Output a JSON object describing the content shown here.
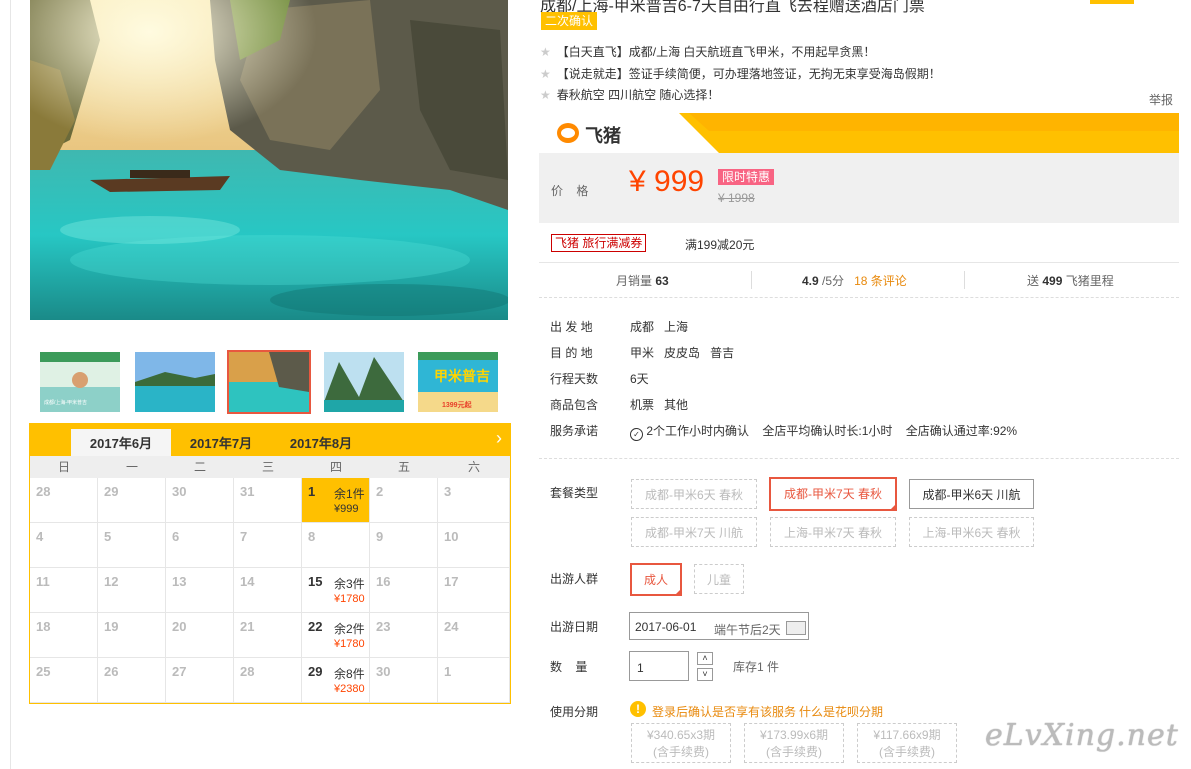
{
  "product": {
    "title_partial": "成都/上海-甲米普吉6-7天自由行直飞去程赠送酒店门票",
    "badge_second_confirm": "二次确认",
    "features": [
      "【白天直飞】成都/上海 白天航班直飞甲米，不用起早贪黑！",
      "【说走就走】签证手续简便，可办理落地签证，无拘无束享受海岛假期！",
      "春秋航空 四川航空 随心选择！"
    ],
    "report_link": "举报"
  },
  "brand": {
    "logo_text": "飞猪"
  },
  "price": {
    "label": "价    格",
    "current": "¥ 999",
    "original": "¥ 1998",
    "promo_tag": "限时特惠"
  },
  "coupon": {
    "tag": "飞猪 旅行满减券",
    "desc": "满199减20元"
  },
  "stats": {
    "monthly_sales_label": "月销量",
    "monthly_sales_value": "63",
    "rating_value": "4.9",
    "rating_suffix": "/5分",
    "reviews_count": "18",
    "reviews_label": "条评论",
    "miles_prefix": "送",
    "miles_value": "499",
    "miles_suffix": "飞猪里程"
  },
  "info": {
    "departure_label": "出 发 地",
    "departure_values": [
      "成都",
      "上海"
    ],
    "destination_label": "目 的 地",
    "destination_values": [
      "甲米",
      "皮皮岛",
      "普吉"
    ],
    "days_label": "行程天数",
    "days_value": "6天",
    "includes_label": "商品包含",
    "includes_values": [
      "机票",
      "其他"
    ],
    "service_label": "服务承诺",
    "service_values": [
      "2个工作小时内确认",
      "全店平均确认时长:1小时",
      "全店确认通过率:92%"
    ]
  },
  "package": {
    "label": "套餐类型",
    "options": [
      {
        "label": "成都-甲米6天 春秋",
        "state": "disabled"
      },
      {
        "label": "成都-甲米7天 春秋",
        "state": "active"
      },
      {
        "label": "成都-甲米6天 川航",
        "state": "normal"
      },
      {
        "label": "成都-甲米7天 川航",
        "state": "disabled"
      },
      {
        "label": "上海-甲米7天 春秋",
        "state": "disabled"
      },
      {
        "label": "上海-甲米6天 春秋",
        "state": "disabled"
      }
    ]
  },
  "traveler": {
    "label": "出游人群",
    "options": [
      {
        "label": "成人",
        "state": "active"
      },
      {
        "label": "儿童",
        "state": "disabled"
      }
    ]
  },
  "date": {
    "label": "出游日期",
    "value": "2017-06-01",
    "note": "端午节后2天"
  },
  "quantity": {
    "label": "数    量",
    "value": "1",
    "stock": "库存1 件"
  },
  "installment": {
    "label": "使用分期",
    "notice": "登录后确认是否享有该服务",
    "link": "什么是花呗分期",
    "options": [
      {
        "line1": "¥340.65x3期",
        "line2": "(含手续费)"
      },
      {
        "line1": "¥173.99x6期",
        "line2": "(含手续费)"
      },
      {
        "line1": "¥117.66x9期",
        "line2": "(含手续费)"
      }
    ]
  },
  "calendar": {
    "tabs": [
      "2017年6月",
      "2017年7月",
      "2017年8月"
    ],
    "weekdays": [
      "日",
      "一",
      "二",
      "三",
      "四",
      "五",
      "六"
    ],
    "rows": [
      [
        {
          "d": "28"
        },
        {
          "d": "29"
        },
        {
          "d": "30"
        },
        {
          "d": "31"
        },
        {
          "d": "1",
          "stock": "余1件",
          "price": "¥999",
          "sel": true
        },
        {
          "d": "2"
        },
        {
          "d": "3"
        }
      ],
      [
        {
          "d": "4"
        },
        {
          "d": "5"
        },
        {
          "d": "6"
        },
        {
          "d": "7"
        },
        {
          "d": "8"
        },
        {
          "d": "9"
        },
        {
          "d": "10"
        }
      ],
      [
        {
          "d": "11"
        },
        {
          "d": "12"
        },
        {
          "d": "13"
        },
        {
          "d": "14"
        },
        {
          "d": "15",
          "stock": "余3件",
          "price": "¥1780"
        },
        {
          "d": "16"
        },
        {
          "d": "17"
        }
      ],
      [
        {
          "d": "18"
        },
        {
          "d": "19"
        },
        {
          "d": "20"
        },
        {
          "d": "21"
        },
        {
          "d": "22",
          "stock": "余2件",
          "price": "¥1780"
        },
        {
          "d": "23"
        },
        {
          "d": "24"
        }
      ],
      [
        {
          "d": "25"
        },
        {
          "d": "26"
        },
        {
          "d": "27"
        },
        {
          "d": "28"
        },
        {
          "d": "29",
          "stock": "余8件",
          "price": "¥2380"
        },
        {
          "d": "30"
        },
        {
          "d": "1"
        }
      ]
    ]
  },
  "thumbnails": [
    {
      "caption": "成都/上海-甲米普吉"
    },
    {
      "caption": ""
    },
    {
      "caption": ""
    },
    {
      "caption": ""
    },
    {
      "caption": "甲米普吉",
      "price": "1399元起"
    }
  ],
  "watermark": "eLvXing.net",
  "colors": {
    "accent": "#ffc000",
    "price_red": "#f40",
    "active_border": "#e8573f"
  }
}
